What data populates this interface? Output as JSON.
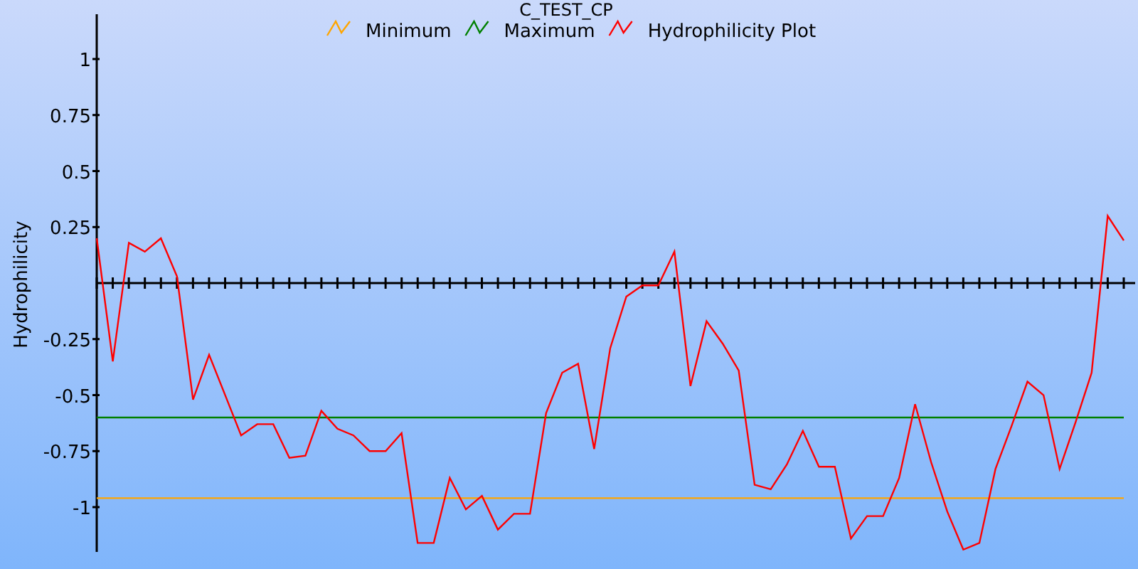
{
  "chart_data": {
    "type": "line",
    "title": "C_TEST_CP",
    "ylabel": "Hydrophilicity",
    "categories": [
      null,
      null,
      null,
      null,
      null,
      null,
      null,
      null,
      null,
      null,
      null,
      null,
      null,
      null,
      null,
      null,
      null,
      null,
      null,
      null,
      null,
      null,
      null,
      null,
      null,
      null,
      null,
      null,
      null,
      null,
      null,
      null,
      null,
      null,
      null,
      null,
      null,
      null,
      null,
      null,
      null,
      null,
      null,
      null,
      null,
      null,
      null,
      null,
      null,
      null,
      null,
      null,
      null,
      null,
      null,
      null,
      null,
      null,
      null,
      null,
      null,
      null,
      null,
      null,
      null
    ],
    "ylim": [
      -1.2,
      1.2
    ],
    "legend": "top",
    "yticks": [
      1,
      0.75,
      0.5,
      0.25,
      -0.25,
      -0.5,
      -0.75,
      -1
    ],
    "series": [
      {
        "name": "Minimum",
        "color": "#ffa500",
        "values": [
          -0.96,
          -0.96,
          -0.96,
          -0.96,
          -0.96,
          -0.96,
          -0.96,
          -0.96,
          -0.96,
          -0.96,
          -0.96,
          -0.96,
          -0.96,
          -0.96,
          -0.96,
          -0.96,
          -0.96,
          -0.96,
          -0.96,
          -0.96,
          -0.96,
          -0.96,
          -0.96,
          -0.96,
          -0.96,
          -0.96,
          -0.96,
          -0.96,
          -0.96,
          -0.96,
          -0.96,
          -0.96,
          -0.96,
          -0.96,
          -0.96,
          -0.96,
          -0.96,
          -0.96,
          -0.96,
          -0.96,
          -0.96,
          -0.96,
          -0.96,
          -0.96,
          -0.96,
          -0.96,
          -0.96,
          -0.96,
          -0.96,
          -0.96,
          -0.96,
          -0.96,
          -0.96,
          -0.96,
          -0.96,
          -0.96,
          -0.96,
          -0.96,
          -0.96,
          -0.96,
          -0.96,
          -0.96,
          -0.96,
          -0.96,
          -0.96
        ]
      },
      {
        "name": "Maximum",
        "color": "#008000",
        "values": [
          -0.6,
          -0.6,
          -0.6,
          -0.6,
          -0.6,
          -0.6,
          -0.6,
          -0.6,
          -0.6,
          -0.6,
          -0.6,
          -0.6,
          -0.6,
          -0.6,
          -0.6,
          -0.6,
          -0.6,
          -0.6,
          -0.6,
          -0.6,
          -0.6,
          -0.6,
          -0.6,
          -0.6,
          -0.6,
          -0.6,
          -0.6,
          -0.6,
          -0.6,
          -0.6,
          -0.6,
          -0.6,
          -0.6,
          -0.6,
          -0.6,
          -0.6,
          -0.6,
          -0.6,
          -0.6,
          -0.6,
          -0.6,
          -0.6,
          -0.6,
          -0.6,
          -0.6,
          -0.6,
          -0.6,
          -0.6,
          -0.6,
          -0.6,
          -0.6,
          -0.6,
          -0.6,
          -0.6,
          -0.6,
          -0.6,
          -0.6,
          -0.6,
          -0.6,
          -0.6,
          -0.6,
          -0.6,
          -0.6,
          -0.6,
          -0.6
        ]
      },
      {
        "name": "Hydrophilicity Plot",
        "color": "#ff0000",
        "values": [
          0.2,
          -0.35,
          0.18,
          0.14,
          0.2,
          0.03,
          -0.52,
          -0.32,
          -0.5,
          -0.68,
          -0.63,
          -0.63,
          -0.78,
          -0.77,
          -0.57,
          -0.65,
          -0.68,
          -0.75,
          -0.75,
          -0.67,
          -1.16,
          -1.16,
          -0.87,
          -1.01,
          -0.95,
          -1.1,
          -1.03,
          -1.03,
          -0.58,
          -0.4,
          -0.36,
          -0.74,
          -0.29,
          -0.06,
          -0.01,
          -0.01,
          0.14,
          -0.46,
          -0.17,
          -0.27,
          -0.39,
          -0.9,
          -0.92,
          -0.81,
          -0.66,
          -0.82,
          -0.82,
          -1.14,
          -1.04,
          -1.04,
          -0.87,
          -0.54,
          -0.8,
          -1.02,
          -1.19,
          -1.16,
          -0.83,
          -0.64,
          -0.44,
          -0.5,
          -0.83,
          -0.62,
          -0.4,
          0.3,
          0.19
        ]
      }
    ]
  }
}
